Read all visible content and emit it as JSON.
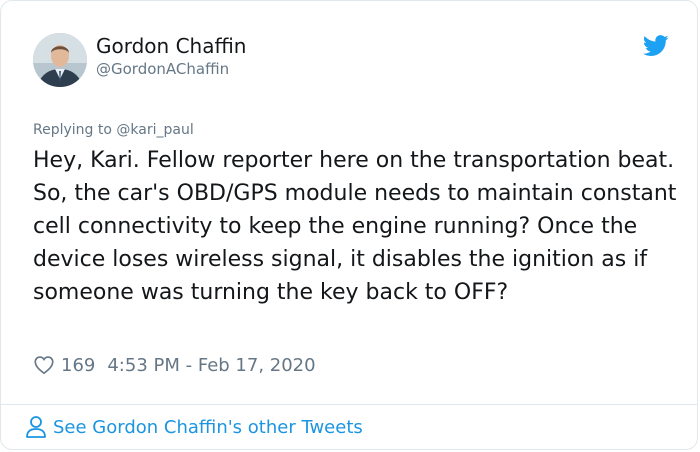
{
  "author": {
    "name": "Gordon Chaffin",
    "handle": "@GordonAChaffin"
  },
  "reply_context": {
    "prefix": "Replying to",
    "handle": "@kari_paul"
  },
  "tweet": {
    "text": "Hey, Kari. Fellow reporter here on the transportation beat. So, the car's OBD/GPS module needs to maintain constant cell connectivity to keep the engine running? Once the device loses wireless signal, it disables the ignition as if someone was turning the key back to OFF?",
    "likes": "169",
    "timestamp": "4:53 PM - Feb 17, 2020"
  },
  "footer": {
    "link_label": "See Gordon Chaffin's other Tweets"
  },
  "icons": {
    "brand": "twitter-bird-icon",
    "like": "heart-icon",
    "profile": "person-icon"
  },
  "colors": {
    "brand_blue": "#1da1f2",
    "link_blue": "#1b95e0",
    "secondary_text": "#657786",
    "primary_text": "#14171a",
    "border": "#e1e8ed"
  }
}
